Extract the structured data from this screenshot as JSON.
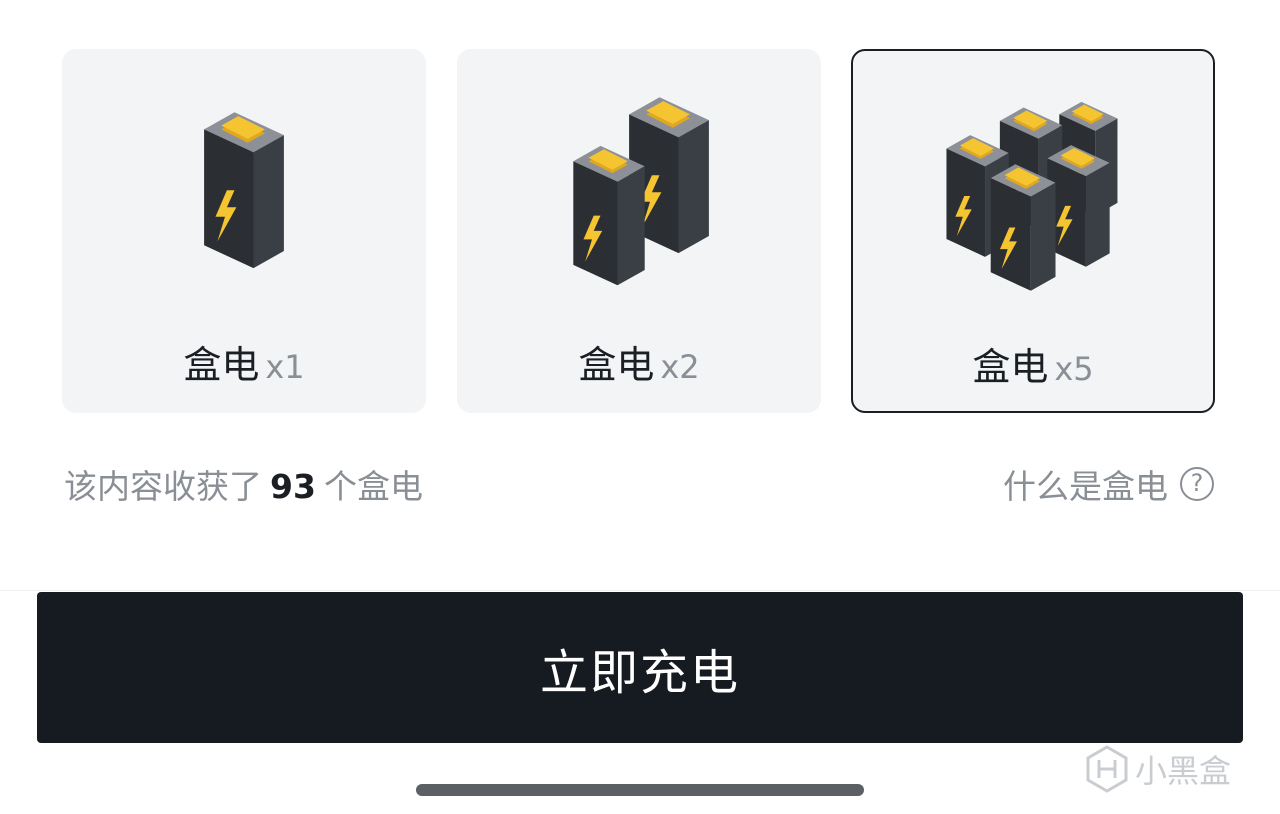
{
  "options": [
    {
      "label": "盒电",
      "multiplier": "x1",
      "selected": false
    },
    {
      "label": "盒电",
      "multiplier": "x2",
      "selected": false
    },
    {
      "label": "盒电",
      "multiplier": "x5",
      "selected": true
    }
  ],
  "info": {
    "collected_prefix": "该内容收获了",
    "collected_count": "93",
    "collected_suffix": "个盒电",
    "what_is_label": "什么是盒电",
    "help_icon": "?"
  },
  "charge_button_label": "立即充电",
  "watermark": {
    "text": "小黑盒"
  },
  "colors": {
    "battery_body": "#2d3136",
    "battery_terminal": "#f5c431",
    "bolt": "#f5c431",
    "button_bg": "#161a21",
    "card_bg": "#f2f4f6"
  }
}
